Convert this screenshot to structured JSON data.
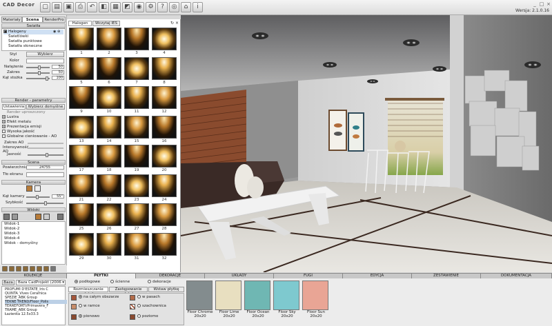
{
  "app": {
    "logo": "CAD Decor",
    "version": "Wersja: 2.1.0.16",
    "toolbar_icons": [
      "new-file-icon",
      "open-folder-icon",
      "save-icon",
      "print-icon",
      "undo-icon",
      "cube-icon",
      "gallery-icon",
      "image-icon",
      "render-icon",
      "settings-icon",
      "help-icon",
      "camera-icon",
      "home-icon",
      "info-icon"
    ]
  },
  "left_tabs": [
    "Materiały",
    "Scena",
    "RenderPro"
  ],
  "lights": {
    "header": "Światła",
    "items": [
      {
        "label": "Halogeny",
        "checked": true
      },
      {
        "label": "Świetlówki",
        "checked": false
      },
      {
        "label": "Światła punktowe",
        "checked": false
      },
      {
        "label": "Światła słoneczne",
        "checked": false
      }
    ],
    "styl_label": "Styl",
    "styl_button": "Wybierz",
    "kolor_label": "Kolor",
    "natezenie_label": "Natężenie",
    "natezenie_value": "50",
    "zakres_label": "Zakres",
    "zakres_value": "50",
    "kat_label": "Kąt stożka",
    "kat_value": "100"
  },
  "render": {
    "header": "Render - parametry",
    "btn_settings": "Ustawienia",
    "btn_default": "Wybierz domyślne",
    "simplified": "Render uproszczony",
    "options": [
      {
        "label": "Lustra",
        "checked": true
      },
      {
        "label": "Efekt metalu",
        "checked": true
      },
      {
        "label": "Prezentacja emisji",
        "checked": true
      },
      {
        "label": "Wysoka jakość",
        "checked": false
      },
      {
        "label": "Globalne cieniowanie - AO",
        "checked": false
      }
    ],
    "zakres_ao": "Zakres AO",
    "intensywnosc_ao": "Intensywność AO",
    "jasnosc": "Jasność"
  },
  "scene": {
    "header": "Scena",
    "powierzchnia_label": "Powierzchnia",
    "powierzchnia_value": "24755",
    "tlo_label": "Tło ekranu"
  },
  "camera": {
    "header": "Kamera",
    "kat_label": "Kąt kamery",
    "kat_value": "55°",
    "szybkosc_label": "Szybkość"
  },
  "views": {
    "header": "Widoki",
    "items": [
      "Widok-1",
      "Widok-2",
      "Widok-3",
      "Widok-4",
      "Widok - domyślny"
    ]
  },
  "gallery": {
    "tabs": [
      "Halogen",
      "Wczytaj IES"
    ],
    "thumbs": [
      "1",
      "2",
      "3",
      "4",
      "5",
      "6",
      "7",
      "8",
      "9",
      "10",
      "11",
      "12",
      "13",
      "14",
      "15",
      "16",
      "17",
      "18",
      "19",
      "20",
      "21",
      "22",
      "23",
      "24",
      "25",
      "26",
      "27",
      "28",
      "29",
      "30",
      "31",
      "32"
    ]
  },
  "bottom_tabs": [
    "KOLEKCJE",
    "PŁYTKI",
    "DEKORACJE",
    "UKŁADY",
    "FUGI",
    "EDYCJA",
    "ZESTAWIENIE",
    "DOKUMENTACJA"
  ],
  "collections": {
    "tab_baza": "Baza",
    "select_value": "Baza CadProjekt (2006",
    "items": [
      "PROFUMI D'ESTATE_Iris C",
      "QUINTA_Vives Ceramica",
      "SPEZIE_ABK Group",
      "TEKNE TREND/Floor_Polis",
      "TERREFORTI/Primavera_F",
      "TRAME_ABK Group",
      "Łazienka 12.5x33.3"
    ],
    "selected_index": 3
  },
  "tiles": {
    "types": [
      {
        "label": "podłogowe",
        "on": true
      },
      {
        "label": "ścienne",
        "on": false
      },
      {
        "label": "dekoracje",
        "on": false
      }
    ],
    "placement_tabs": [
      "Rozmieszczanie płytek",
      "Zastępowanie płytek",
      "Wstaw płytkę"
    ],
    "placement_options": [
      {
        "label": "na całym obszarze",
        "on": true
      },
      {
        "label": "w pasach",
        "on": false
      },
      {
        "label": "w ramce",
        "on": false
      },
      {
        "label": "szachownica",
        "on": false
      },
      {
        "label": "pionowo",
        "on": true
      },
      {
        "label": "poziomo",
        "on": false
      }
    ]
  },
  "swatches": [
    {
      "name": "Floor Chrome",
      "size": "20x20",
      "color": "#838c8e"
    },
    {
      "name": "Floor Lime",
      "size": "20x20",
      "color": "#e8dfc0"
    },
    {
      "name": "Floor Ocean",
      "size": "20x20",
      "color": "#6fb7b3"
    },
    {
      "name": "Floor Sky",
      "size": "20x20",
      "color": "#7ec9cf"
    },
    {
      "name": "Floor Sun",
      "size": "20x20",
      "color": "#e9a595"
    }
  ]
}
